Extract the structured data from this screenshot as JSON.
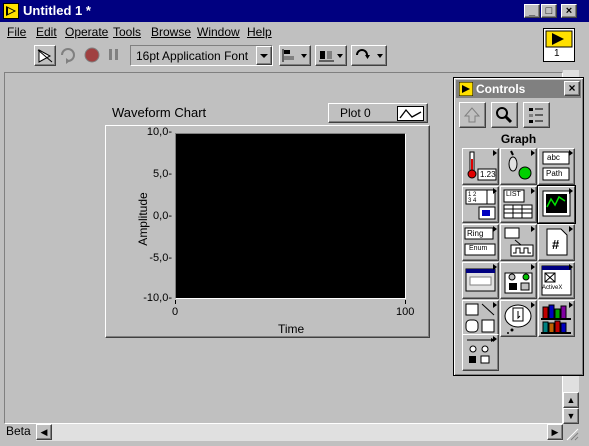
{
  "window": {
    "title": "Untitled 1 *"
  },
  "menu": [
    "File",
    "Edit",
    "Operate",
    "Tools",
    "Browse",
    "Window",
    "Help"
  ],
  "toolbar": {
    "font": "16pt Application Font"
  },
  "conn_pane": {
    "number": "1"
  },
  "chart": {
    "title": "Waveform Chart",
    "legend": "Plot 0",
    "xlabel": "Time",
    "ylabel": "Amplitude",
    "ticks_y": [
      "10,0-",
      "5,0-",
      "0,0-",
      "-5,0-",
      "-10,0-"
    ],
    "ticks_x": [
      "0",
      "100"
    ]
  },
  "chart_data": {
    "type": "line",
    "title": "Waveform Chart",
    "xlabel": "Time",
    "ylabel": "Amplitude",
    "series": [
      {
        "name": "Plot 0",
        "values": []
      }
    ],
    "xlim": [
      0,
      100
    ],
    "ylim": [
      -10,
      10
    ],
    "grid": false,
    "legend": "top-right"
  },
  "palette": {
    "title": "Controls",
    "heading": "Graph",
    "icons": [
      "numeric-icon",
      "boolean-icon",
      "string-path-icon",
      "array-cluster-icon",
      "list-table-icon",
      "graph-icon",
      "ring-enum-icon",
      "io-icon",
      "refnum-icon",
      "dialog-controls-icon",
      "classic-controls-icon",
      "activex-icon",
      "decorations-icon",
      "select-control-icon",
      "user-controls-icon",
      "express-icon"
    ],
    "cell_labels": {
      "numeric": "1.23",
      "string": "abc",
      "path": "Path",
      "list": "LIST",
      "ring": "Ring",
      "enum": "Enum",
      "activex": "ActiveX",
      "refnum": "#"
    }
  },
  "status": {
    "beta": "Beta"
  }
}
